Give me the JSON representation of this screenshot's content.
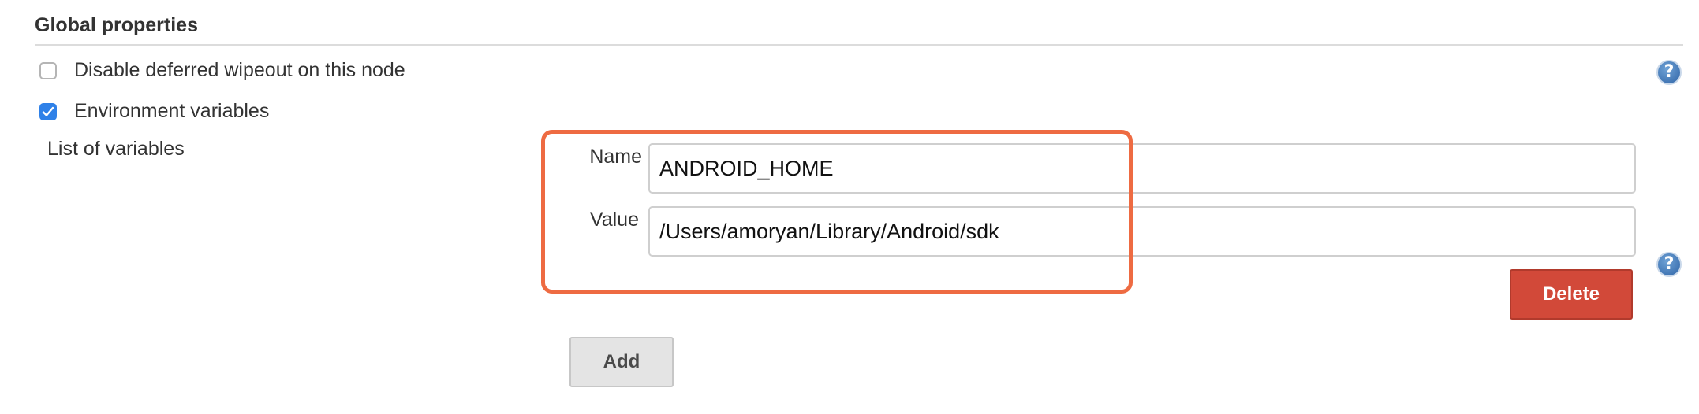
{
  "section": {
    "title": "Global properties"
  },
  "options": [
    {
      "label": "Disable deferred wipeout on this node",
      "checked": false
    },
    {
      "label": "Environment variables",
      "checked": true
    }
  ],
  "variables": {
    "list_label": "List of variables",
    "entries": [
      {
        "name_label": "Name",
        "name_value": "ANDROID_HOME",
        "value_label": "Value",
        "value_value": "/Users/amoryan/Library/Android/sdk"
      }
    ],
    "delete_label": "Delete",
    "add_label": "Add"
  },
  "help_icon": "?",
  "colors": {
    "highlight": "#ee6b42",
    "checkbox_checked": "#2f81e8",
    "delete_button": "#d24939",
    "add_button": "#e4e4e4"
  }
}
